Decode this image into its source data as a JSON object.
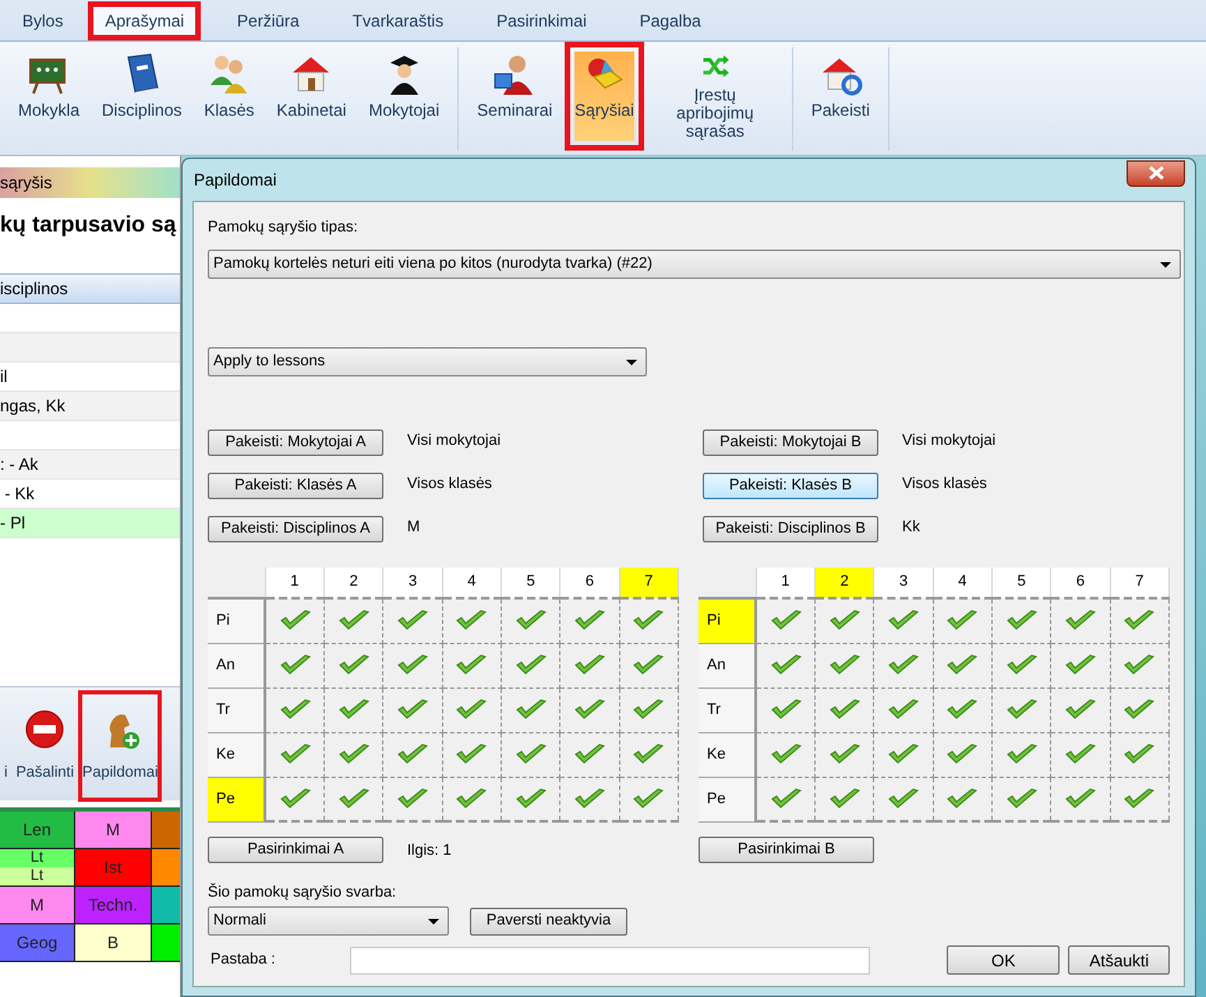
{
  "menu_tabs": [
    {
      "label": "Bylos",
      "selected": false,
      "highlighted": false
    },
    {
      "label": "Aprašymai",
      "selected": true,
      "highlighted": true
    },
    {
      "label": "Peržiūra",
      "selected": false,
      "highlighted": false
    },
    {
      "label": "Tvarkaraštis",
      "selected": false,
      "highlighted": false
    },
    {
      "label": "Pasirinkimai",
      "selected": false,
      "highlighted": false
    },
    {
      "label": "Pagalba",
      "selected": false,
      "highlighted": false
    }
  ],
  "ribbon": {
    "groups": [
      {
        "items": [
          {
            "label": "Mokykla",
            "selected": false,
            "highlighted": false
          },
          {
            "label": "Disciplinos",
            "selected": false,
            "highlighted": false
          },
          {
            "label": "Klasės",
            "selected": false,
            "highlighted": false
          },
          {
            "label": "Kabinetai",
            "selected": false,
            "highlighted": false
          },
          {
            "label": "Mokytojai",
            "selected": false,
            "highlighted": false
          }
        ]
      },
      {
        "items": [
          {
            "label": "Seminarai",
            "selected": false,
            "highlighted": false
          },
          {
            "label": "Sąryšiai",
            "selected": true,
            "highlighted": true
          },
          {
            "label": "Įrestų apribojimų sąrašas",
            "selected": false,
            "highlighted": false
          }
        ]
      },
      {
        "items": [
          {
            "label": "Pakeisti",
            "selected": false,
            "highlighted": false
          }
        ]
      }
    ]
  },
  "back_window": {
    "title": "sąryšis",
    "heading": "kų tarpusavio są",
    "column": "isciplinos",
    "rows": [
      {
        "selected": false
      },
      {
        "selected": false
      },
      {
        "text": "il",
        "selected": false
      },
      {
        "text": "ngas, Kk",
        "selected": false
      },
      {
        "selected": false
      },
      {
        "text": ": - Ak",
        "selected": false
      },
      {
        "text": " - Kk",
        "selected": false
      },
      {
        "text": "- Pl",
        "selected": true
      }
    ],
    "buttons": [
      {
        "label": "i",
        "highlighted": false
      },
      {
        "label": "Pašalinti",
        "highlighted": false
      },
      {
        "label": "Papildomai",
        "highlighted": true
      }
    ]
  },
  "timetable": [
    [
      {
        "text": "Len",
        "color": "#22bb44"
      },
      {
        "text": "M",
        "color": "#ff88ee"
      },
      {
        "color": "#cc6600"
      }
    ],
    [
      {
        "kind": "split",
        "parts": [
          {
            "text": "Lt",
            "color": "#66ff66"
          },
          {
            "text": "Lt",
            "color": "#ccff99"
          }
        ]
      },
      {
        "text": "Ist",
        "color": "#ff0000"
      },
      {
        "color": "#ff8800"
      }
    ],
    [
      {
        "text": "M",
        "color": "#ff88ee"
      },
      {
        "text": "Techn.",
        "color": "#bb22ff"
      },
      {
        "color": "#11bbaa"
      }
    ],
    [
      {
        "text": "Geog",
        "color": "#6666ff"
      },
      {
        "text": "B",
        "color": "#ffffcc"
      },
      {
        "color": "#00ee00"
      }
    ]
  ],
  "dialog": {
    "title": "Papildomai",
    "type_label": "Pamokų sąryšio tipas:",
    "type_value": "Pamokų kortelės neturi eiti viena po kitos (nurodyta tvarka) (#22)",
    "apply_value": "Apply to lessons",
    "filters": [
      {
        "a": {
          "button": "Pakeisti: Mokytojai A",
          "value": "Visi mokytojai",
          "focused": false
        },
        "b": {
          "button": "Pakeisti: Mokytojai B",
          "value": "Visi mokytojai",
          "focused": false
        }
      },
      {
        "a": {
          "button": "Pakeisti: Klasės A",
          "value": "Visos klasės",
          "focused": false
        },
        "b": {
          "button": "Pakeisti: Klasės B",
          "value": "Visos klasės",
          "focused": true
        }
      },
      {
        "a": {
          "button": "Pakeisti: Disciplinos A",
          "value": "M",
          "focused": false
        },
        "b": {
          "button": "Pakeisti: Disciplinos B",
          "value": "Kk",
          "focused": false
        }
      }
    ],
    "grids": [
      {
        "columns": [
          {
            "label": "1",
            "highlighted": false
          },
          {
            "label": "2",
            "highlighted": false
          },
          {
            "label": "3",
            "highlighted": false
          },
          {
            "label": "4",
            "highlighted": false
          },
          {
            "label": "5",
            "highlighted": false
          },
          {
            "label": "6",
            "highlighted": false
          },
          {
            "label": "7",
            "highlighted": true
          }
        ],
        "rows": [
          {
            "label": "Pi",
            "highlighted": false,
            "checked": [
              true,
              true,
              true,
              true,
              true,
              true,
              true
            ]
          },
          {
            "label": "An",
            "highlighted": false,
            "checked": [
              true,
              true,
              true,
              true,
              true,
              true,
              true
            ]
          },
          {
            "label": "Tr",
            "highlighted": false,
            "checked": [
              true,
              true,
              true,
              true,
              true,
              true,
              true
            ]
          },
          {
            "label": "Ke",
            "highlighted": false,
            "checked": [
              true,
              true,
              true,
              true,
              true,
              true,
              true
            ]
          },
          {
            "label": "Pe",
            "highlighted": true,
            "checked": [
              true,
              true,
              true,
              true,
              true,
              true,
              true
            ]
          }
        ],
        "options_button": "Pasirinkimai A",
        "length": "Ilgis: 1"
      },
      {
        "columns": [
          {
            "label": "1",
            "highlighted": false
          },
          {
            "label": "2",
            "highlighted": true
          },
          {
            "label": "3",
            "highlighted": false
          },
          {
            "label": "4",
            "highlighted": false
          },
          {
            "label": "5",
            "highlighted": false
          },
          {
            "label": "6",
            "highlighted": false
          },
          {
            "label": "7",
            "highlighted": false
          }
        ],
        "rows": [
          {
            "label": "Pi",
            "highlighted": true,
            "checked": [
              true,
              true,
              true,
              true,
              true,
              true,
              true
            ]
          },
          {
            "label": "An",
            "highlighted": false,
            "checked": [
              true,
              true,
              true,
              true,
              true,
              true,
              true
            ]
          },
          {
            "label": "Tr",
            "highlighted": false,
            "checked": [
              true,
              true,
              true,
              true,
              true,
              true,
              true
            ]
          },
          {
            "label": "Ke",
            "highlighted": false,
            "checked": [
              true,
              true,
              true,
              true,
              true,
              true,
              true
            ]
          },
          {
            "label": "Pe",
            "highlighted": false,
            "checked": [
              true,
              true,
              true,
              true,
              true,
              true,
              true
            ]
          }
        ],
        "options_button": "Pasirinkimai B"
      }
    ],
    "importance_label": "Šio pamokų sąryšio svarba:",
    "importance_value": "Normali",
    "deactivate_button": "Paversti neaktyvia",
    "note_label": "Pastaba :",
    "ok_button": "OK",
    "cancel_button": "Atšaukti"
  }
}
